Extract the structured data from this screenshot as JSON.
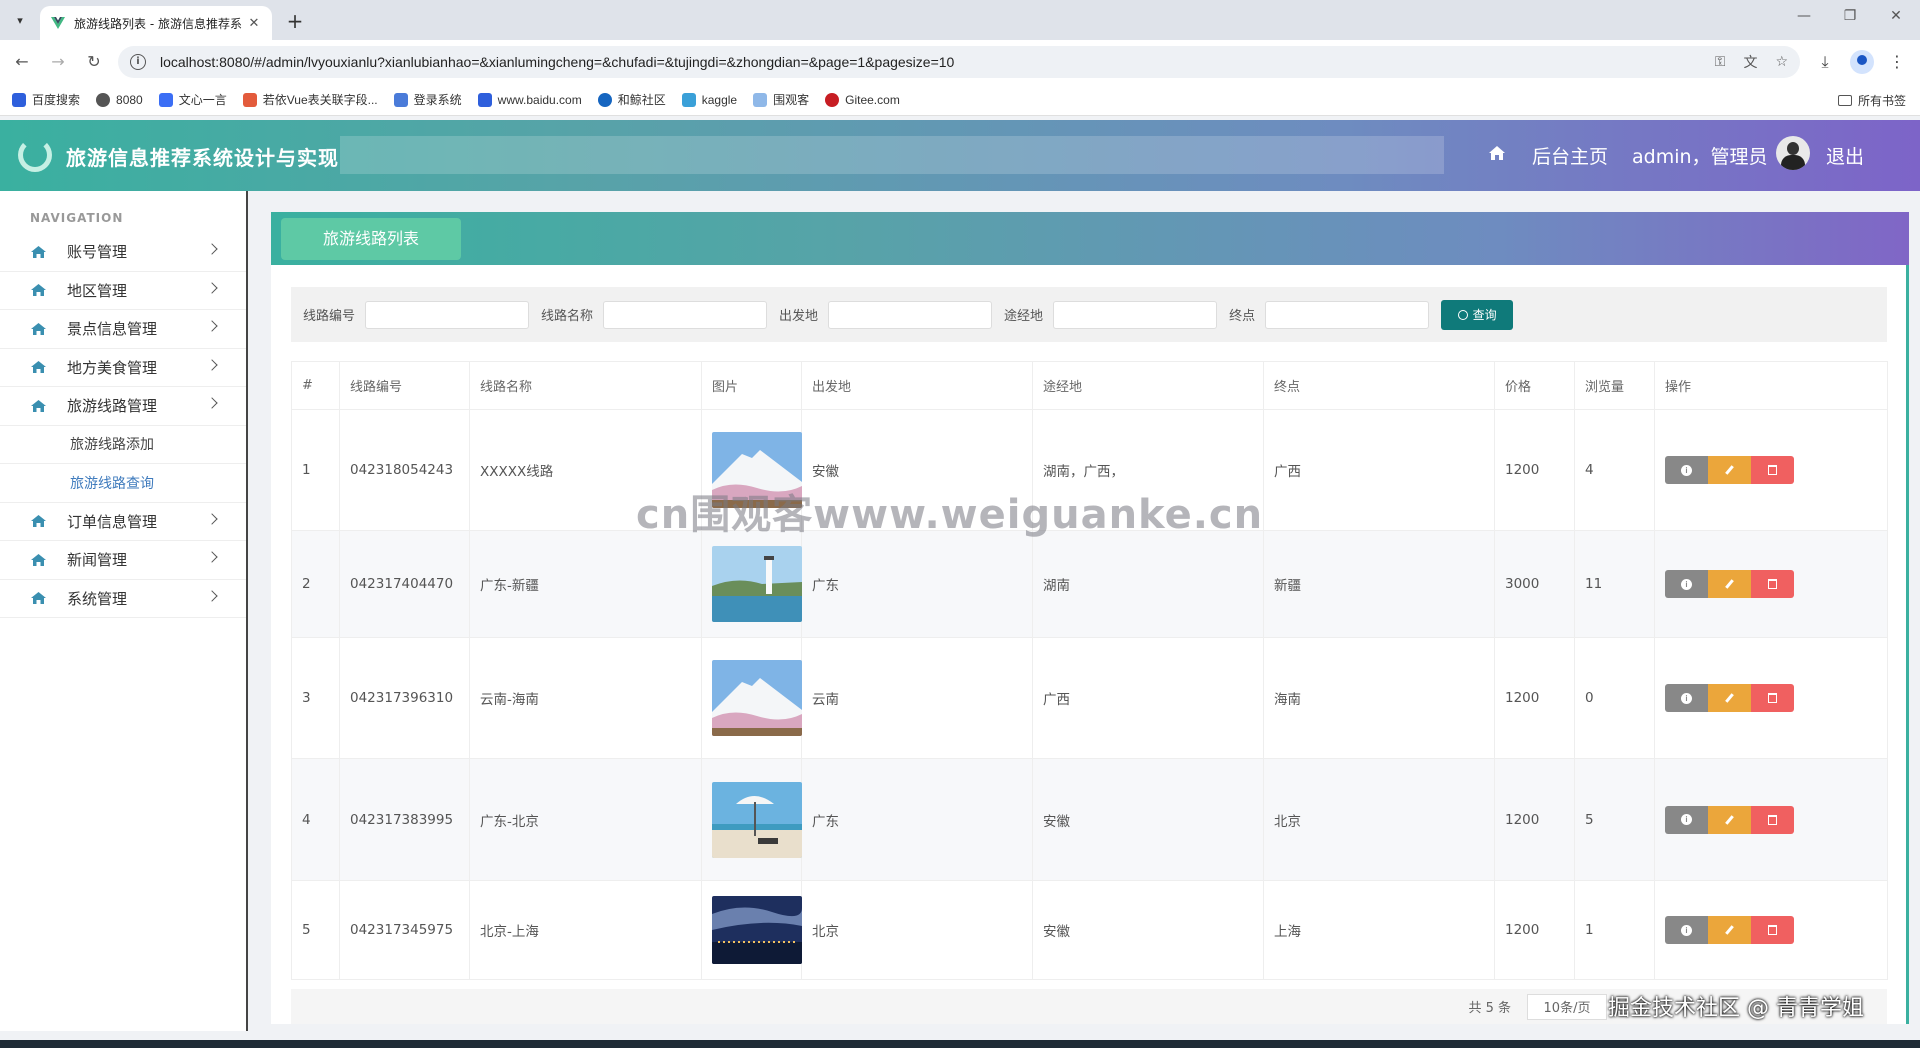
{
  "browser": {
    "tab_title": "旅游线路列表 - 旅游信息推荐系",
    "url": "localhost:8080/#/admin/lvyouxianlu?xianlubianhao=&xianlumingcheng=&chufadi=&tujingdi=&zhongdian=&page=1&pagesize=10",
    "bookmarks": [
      "百度搜索",
      "8080",
      "文心一言",
      "若依Vue表关联字段...",
      "登录系统",
      "www.baidu.com",
      "和鲸社区",
      "kaggle",
      "围观客",
      "Gitee.com"
    ],
    "all_bookmarks": "所有书签"
  },
  "header": {
    "app_title": "旅游信息推荐系统设计与实现",
    "home_link": "后台主页",
    "user_label": "admin，管理员",
    "logout": "退出"
  },
  "sidebar": {
    "caption": "NAVIGATION",
    "items": [
      {
        "label": "账号管理"
      },
      {
        "label": "地区管理"
      },
      {
        "label": "景点信息管理"
      },
      {
        "label": "地方美食管理"
      },
      {
        "label": "旅游线路管理"
      },
      {
        "label": "订单信息管理"
      },
      {
        "label": "新闻管理"
      },
      {
        "label": "系统管理"
      }
    ],
    "subitems": [
      {
        "label": "旅游线路添加"
      },
      {
        "label": "旅游线路查询"
      }
    ]
  },
  "page": {
    "title_tab": "旅游线路列表",
    "search": {
      "labels": [
        "线路编号",
        "线路名称",
        "出发地",
        "途经地",
        "终点"
      ],
      "button": "查询"
    },
    "table": {
      "headers": [
        "#",
        "线路编号",
        "线路名称",
        "图片",
        "出发地",
        "途经地",
        "终点",
        "价格",
        "浏览量",
        "操作"
      ],
      "rows": [
        {
          "idx": "1",
          "code": "042318054243",
          "name": "XXXXX线路",
          "img": "mountain",
          "from": "安徽",
          "via": "湖南，广西，",
          "to": "广西",
          "price": "1200",
          "views": "4"
        },
        {
          "idx": "2",
          "code": "042317404470",
          "name": "广东-新疆",
          "img": "lighthouse",
          "from": "广东",
          "via": "湖南",
          "to": "新疆",
          "price": "3000",
          "views": "11"
        },
        {
          "idx": "3",
          "code": "042317396310",
          "name": "云南-海南",
          "img": "mountain",
          "from": "云南",
          "via": "广西",
          "to": "海南",
          "price": "1200",
          "views": "0"
        },
        {
          "idx": "4",
          "code": "042317383995",
          "name": "广东-北京",
          "img": "beach",
          "from": "广东",
          "via": "安徽",
          "to": "北京",
          "price": "1200",
          "views": "5"
        },
        {
          "idx": "5",
          "code": "042317345975",
          "name": "北京-上海",
          "img": "night",
          "from": "北京",
          "via": "安徽",
          "to": "上海",
          "price": "1200",
          "views": "1"
        }
      ]
    },
    "pager": {
      "total": "共 5 条",
      "page_size": "10条/页"
    }
  },
  "watermarks": {
    "center": "cn围观客www.weiguanke.cn",
    "corner": "掘金技术社区 @ 青青学姐"
  },
  "colors": {
    "header_start": "#3ab0a0",
    "header_end": "#7d64c8",
    "search_button": "#0f7a7a",
    "edit": "#eba63b",
    "delete": "#f06060",
    "detail": "#888888",
    "active_sub": "#3f7bbd"
  }
}
